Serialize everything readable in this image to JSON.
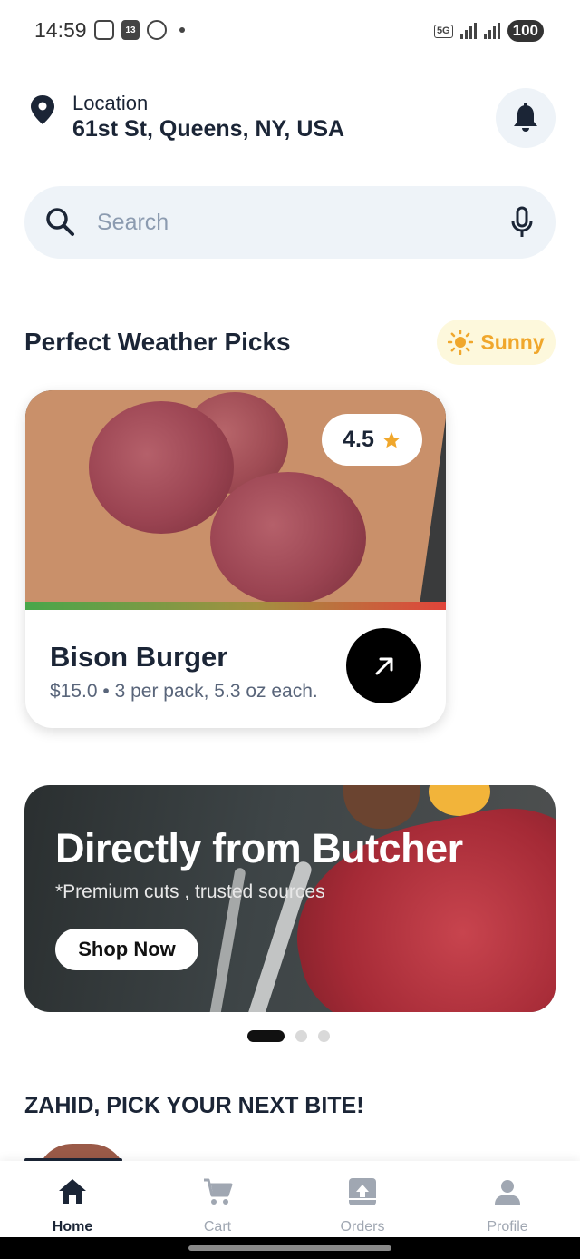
{
  "status_bar": {
    "time": "14:59",
    "calendar_day": "13",
    "network": "5G",
    "battery": "100"
  },
  "header": {
    "location_label": "Location",
    "location_value": "61st St, Queens, NY, USA",
    "icons": {
      "location": "location-pin-icon",
      "notifications": "bell-icon"
    }
  },
  "search": {
    "placeholder": "Search",
    "value": "",
    "icons": {
      "search": "search-icon",
      "voice": "microphone-icon"
    }
  },
  "weather_picks": {
    "title": "Perfect Weather Picks",
    "weather": "Sunny",
    "weather_icon": "sun-icon",
    "accent_color": "#f0a72c"
  },
  "product": {
    "name": "Bison Burger",
    "meta": "$15.0 • 3 per pack, 5.3 oz each.",
    "rating": "4.5",
    "rating_icon": "star-icon",
    "action_icon": "arrow-up-right-icon"
  },
  "banner": {
    "title": "Directly from Butcher",
    "subtitle": "*Premium cuts , trusted sources",
    "button_label": "Shop Now",
    "slide_count": 3,
    "active_slide": 1
  },
  "picks": {
    "title": "ZAHID, PICK YOUR NEXT BITE!"
  },
  "bottom_nav": {
    "items": [
      {
        "label": "Home",
        "icon": "home-icon",
        "active": true
      },
      {
        "label": "Cart",
        "icon": "cart-icon",
        "active": false
      },
      {
        "label": "Orders",
        "icon": "orders-icon",
        "active": false
      },
      {
        "label": "Profile",
        "icon": "profile-icon",
        "active": false
      }
    ]
  },
  "colors": {
    "text_primary": "#1b2536",
    "surface": "#eef3f8",
    "inactive": "#a0a7b2"
  }
}
